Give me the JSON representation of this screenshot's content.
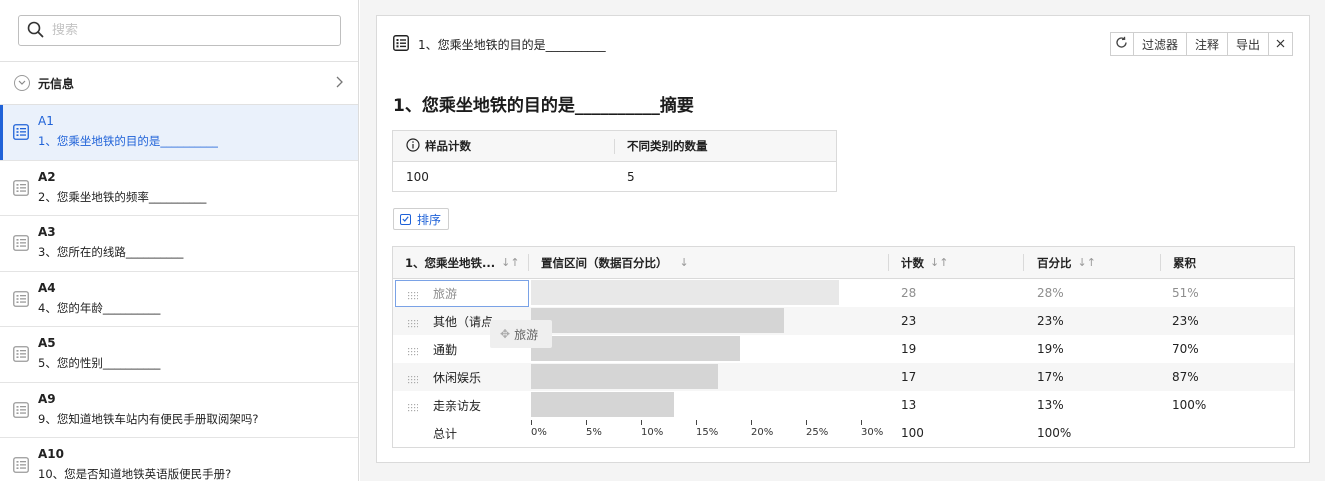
{
  "search": {
    "placeholder": "搜索"
  },
  "meta": {
    "label": "元信息"
  },
  "sidebar": {
    "items": [
      {
        "code": "A1",
        "title": "1、您乘坐地铁的目的是__________",
        "active": true
      },
      {
        "code": "A2",
        "title": "2、您乘坐地铁的频率__________"
      },
      {
        "code": "A3",
        "title": "3、您所在的线路__________"
      },
      {
        "code": "A4",
        "title": "4、您的年龄__________"
      },
      {
        "code": "A5",
        "title": "5、您的性别__________"
      },
      {
        "code": "A9",
        "title": "9、您知道地铁车站内有便民手册取阅架吗?"
      },
      {
        "code": "A10",
        "title": "10、您是否知道地铁英语版便民手册?"
      }
    ]
  },
  "panel": {
    "header_title": "1、您乘坐地铁的目的是__________",
    "toolbar": {
      "filter": "过滤器",
      "annotate": "注释",
      "export": "导出"
    },
    "summary_title": "1、您乘坐地铁的目的是__________摘要",
    "stats": {
      "col1": "样品计数",
      "col2": "不同类别的数量",
      "val1": "100",
      "val2": "5"
    },
    "sort_label": "排序",
    "ghost_label": "旅游"
  },
  "table": {
    "headers": [
      "1、您乘坐地铁...",
      "置信区间（数据百分比）",
      "计数",
      "百分比",
      "累积"
    ],
    "rows": [
      {
        "category": "旅游",
        "count": "28",
        "percent": "28%",
        "cumulative": "51%"
      },
      {
        "category": "其他（请点",
        "count": "23",
        "percent": "23%",
        "cumulative": "23%"
      },
      {
        "category": "通勤",
        "count": "19",
        "percent": "19%",
        "cumulative": "70%"
      },
      {
        "category": "休闲娱乐",
        "count": "17",
        "percent": "17%",
        "cumulative": "87%"
      },
      {
        "category": "走亲访友",
        "count": "13",
        "percent": "13%",
        "cumulative": "100%"
      }
    ],
    "total": {
      "label": "总计",
      "count": "100",
      "percent": "100%"
    },
    "axis_ticks": [
      "0%",
      "5%",
      "10%",
      "15%",
      "20%",
      "25%",
      "30%"
    ]
  },
  "chart_data": {
    "type": "bar",
    "categories": [
      "旅游",
      "其他（请点",
      "通勤",
      "休闲娱乐",
      "走亲访友"
    ],
    "values": [
      28,
      23,
      19,
      17,
      13
    ],
    "xlim": [
      0,
      30
    ]
  }
}
